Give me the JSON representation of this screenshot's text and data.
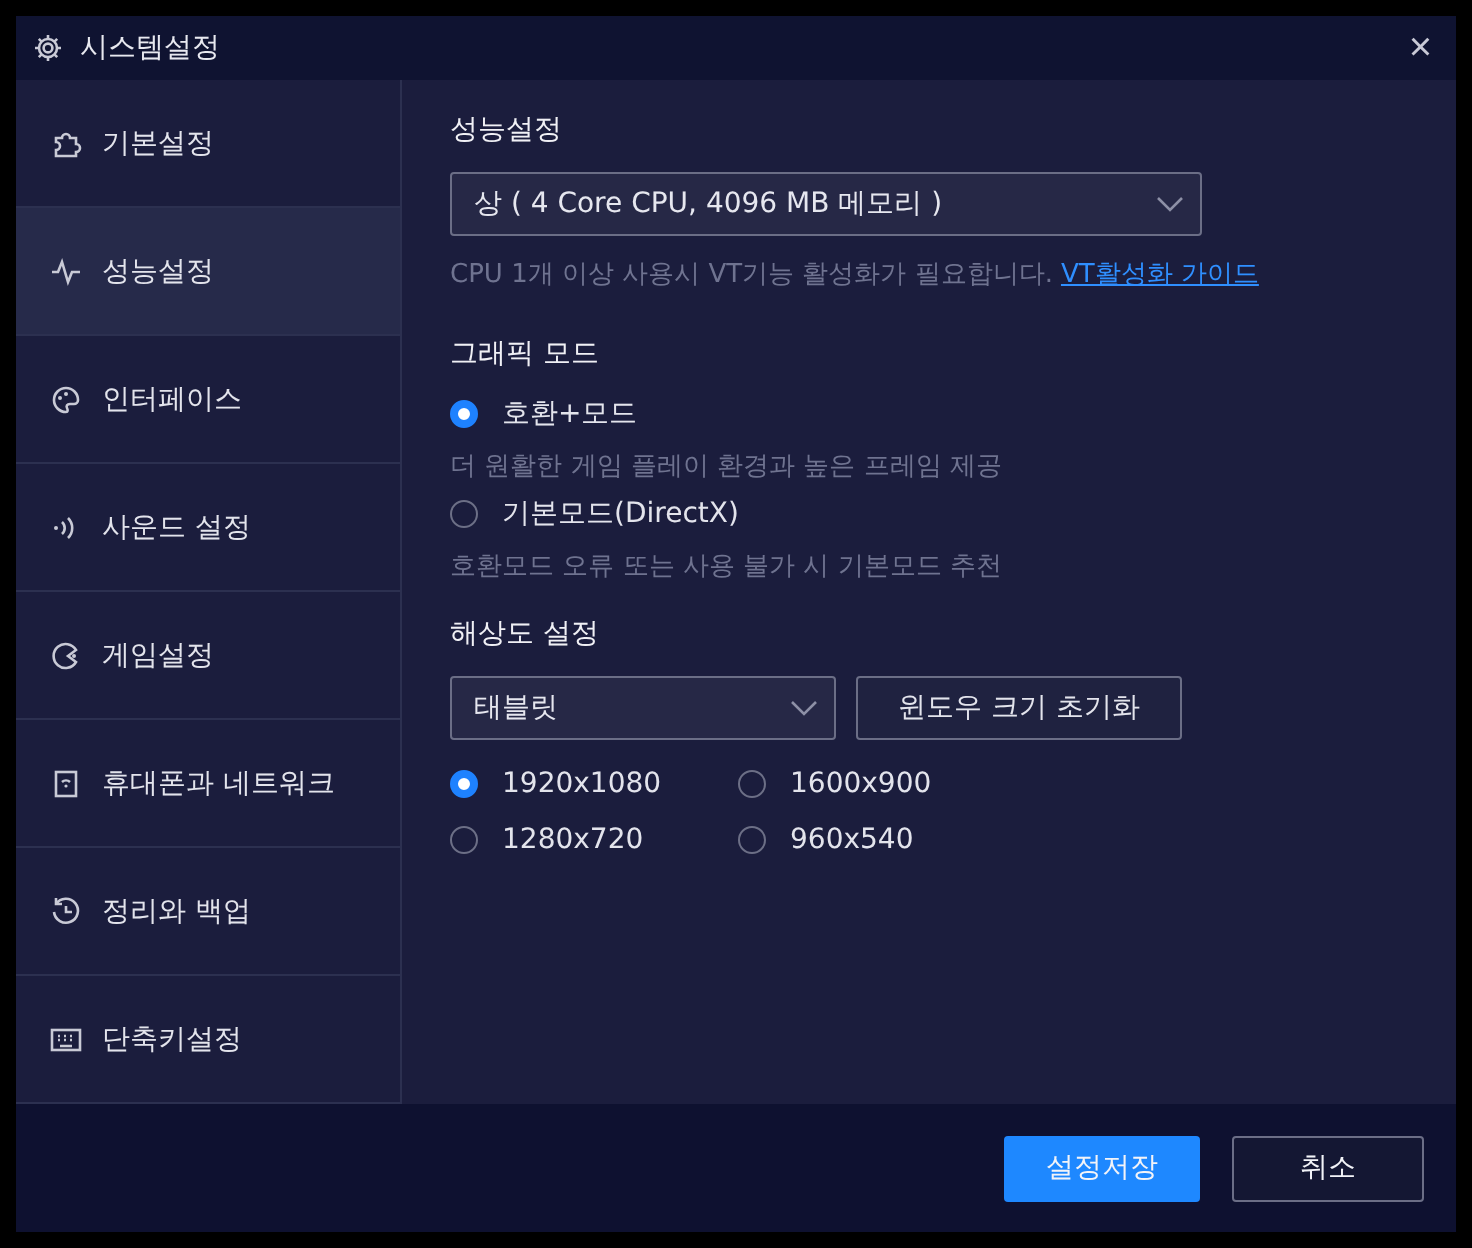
{
  "window": {
    "title": "시스템설정",
    "close": "×"
  },
  "sidebar": {
    "items": [
      {
        "label": "기본설정",
        "selected": false
      },
      {
        "label": "성능설정",
        "selected": true
      },
      {
        "label": "인터페이스",
        "selected": false
      },
      {
        "label": "사운드 설정",
        "selected": false
      },
      {
        "label": "게임설정",
        "selected": false
      },
      {
        "label": "휴대폰과 네트워크",
        "selected": false
      },
      {
        "label": "정리와 백업",
        "selected": false
      },
      {
        "label": "단축키설정",
        "selected": false
      }
    ]
  },
  "performance": {
    "title": "성능설정",
    "select_value": "상 ( 4 Core CPU, 4096 MB 메모리 )",
    "hint": "CPU 1개 이상 사용시 VT기능 활성화가 필요합니다.",
    "link": "VT활성화 가이드"
  },
  "graphics": {
    "title": "그래픽 모드",
    "options": [
      {
        "label": "호환+모드",
        "description": "더 원활한 게임 플레이 환경과 높은 프레임 제공",
        "selected": true
      },
      {
        "label": "기본모드(DirectX)",
        "description": "호환모드 오류 또는 사용 불가 시 기본모드 추천",
        "selected": false
      }
    ]
  },
  "resolution": {
    "title": "해상도 설정",
    "select_value": "태블릿",
    "reset_button": "윈도우 크기 초기화",
    "options": [
      {
        "label": "1920x1080",
        "selected": true
      },
      {
        "label": "1600x900",
        "selected": false
      },
      {
        "label": "1280x720",
        "selected": false
      },
      {
        "label": "960x540",
        "selected": false
      }
    ]
  },
  "buttons": [
    {
      "kind": "primary",
      "label": "설정저장"
    },
    {
      "kind": "secondary",
      "label": "취소"
    }
  ]
}
